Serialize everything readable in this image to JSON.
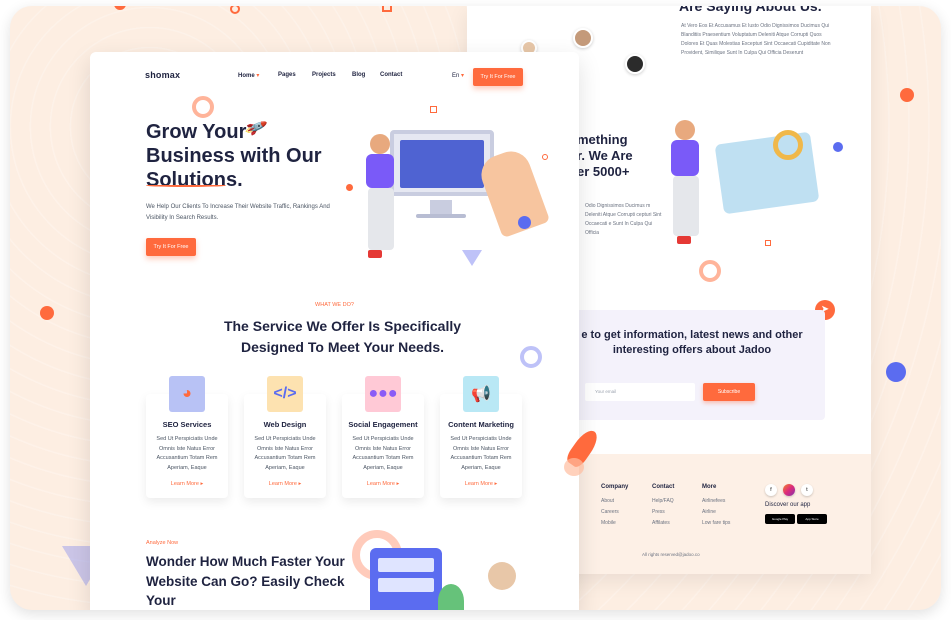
{
  "front": {
    "logo": "shomax",
    "nav": [
      "Home",
      "Pages",
      "Projects",
      "Blog",
      "Contact"
    ],
    "lang": "En",
    "try_label": "Try It For Free",
    "hero": {
      "title": "Grow Your Business with Our Solutions.",
      "subtitle": "We Help Our Clients To Increase Their Website Traffic, Rankings And Visibility In Search Results.",
      "cta": "Try It For Free"
    },
    "services": {
      "eyebrow": "WHAT WE DO?",
      "title": "The Service We Offer Is Specifically Designed To Meet Your Needs.",
      "cards": [
        {
          "title": "SEO Services",
          "desc": "Sed Ut Perspiciatis Unde Omnis Iste Natus Error Accusantium Totam Rem Aperiam, Eaque",
          "link": "Learn More"
        },
        {
          "title": "Web Design",
          "desc": "Sed Ut Perspiciatis Unde Omnis Iste Natus Error Accusantium Totam Rem Aperiam, Eaque",
          "link": "Learn More"
        },
        {
          "title": "Social Engagement",
          "desc": "Sed Ut Perspiciatis Unde Omnis Iste Natus Error Accusantium Totam Rem Aperiam, Eaque",
          "link": "Learn More"
        },
        {
          "title": "Content Marketing",
          "desc": "Sed Ut Perspiciatis Unde Omnis Iste Natus Error Accusantium Totam Rem Aperiam, Eaque",
          "link": "Learn More"
        }
      ]
    },
    "analyze": {
      "eyebrow": "Analyze Now",
      "title": "Wonder How Much Faster Your Website Can Go? Easily Check Your"
    }
  },
  "back": {
    "testimonial_title": "Are Saying About Us.",
    "testimonial_text": "At Vero Eos Et Accusamus Et Iusto Odio Dignissimos Ducimus Qui Blanditiis Praesentium Voluptatum Deleniti Atque Corrupti Quos Dolores Et Quas Molestias Excepturi Sint Occaecati Cupiditate Non Provident, Similique Sunt In Culpa Qui Officia Deserunt",
    "mid_title": "mething r. We Are er 5000+",
    "mid_text": "Odio Dignissimos Ducimus m Deleniti Atque Corrupti cepturi Sint Occaecati e Sunt In Culpa Qui Officia",
    "subscribe": {
      "title": "e to get information, latest news and other interesting offers about Jadoo",
      "placeholder": "Your email",
      "button": "Subscribe"
    },
    "footer": {
      "columns": [
        {
          "heading": "Company",
          "links": [
            "About",
            "Careers",
            "Mobile"
          ]
        },
        {
          "heading": "Contact",
          "links": [
            "Help/FAQ",
            "Press",
            "Affilates"
          ]
        },
        {
          "heading": "More",
          "links": [
            "Airlinefees",
            "Airline",
            "Low fare tips"
          ]
        }
      ],
      "social": [
        "f",
        "",
        "t"
      ],
      "discover": "Discover our app",
      "stores": [
        "Google Play",
        "App Store"
      ],
      "copyright": "All rights reserved@jadoo.co"
    }
  },
  "colors": {
    "accent": "#ff6a3d",
    "navy": "#1f2340",
    "blue": "#4f63d2"
  }
}
